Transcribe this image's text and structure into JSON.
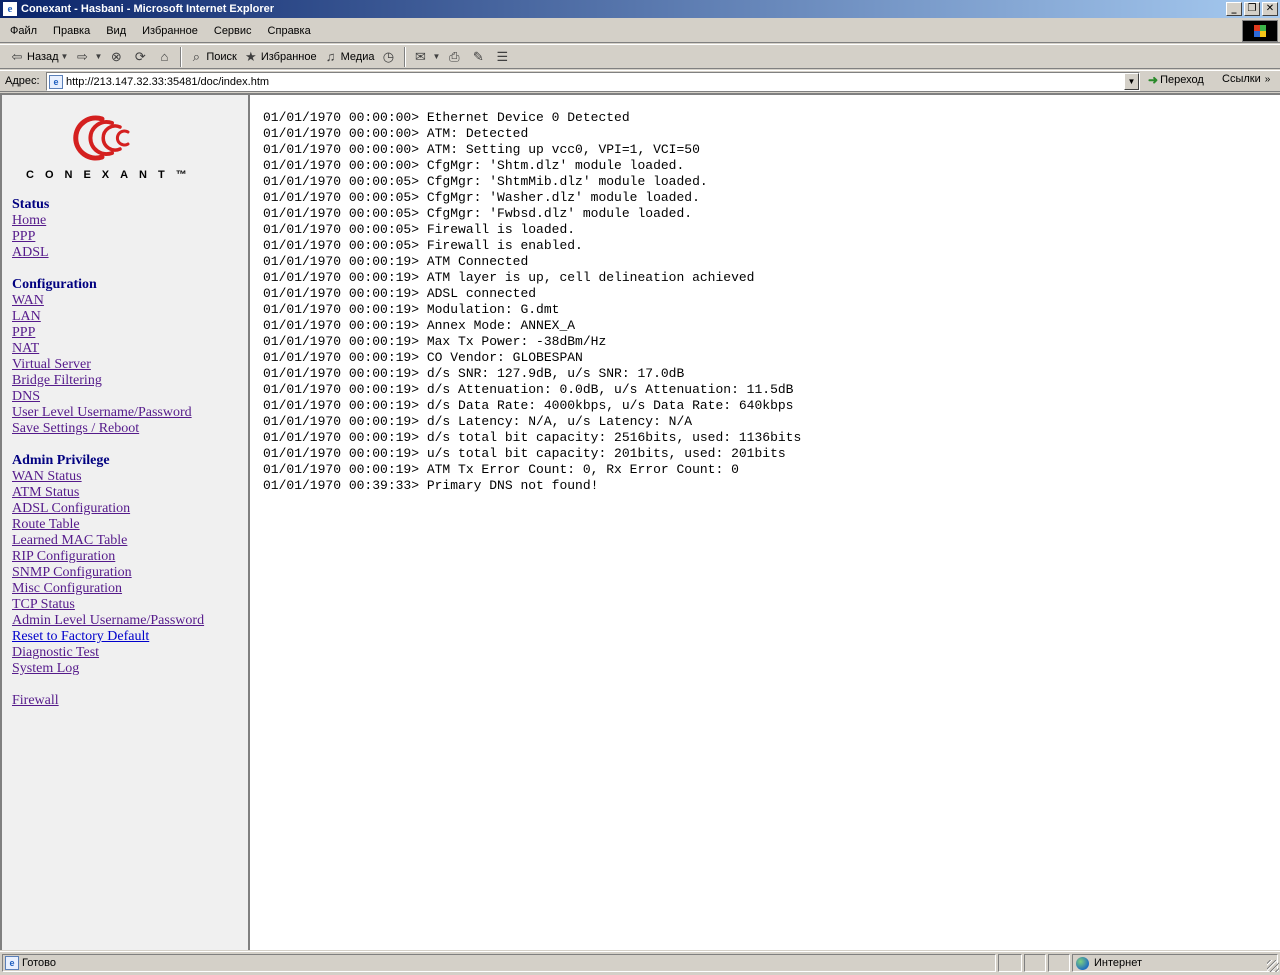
{
  "window": {
    "title": "Conexant - Hasbani - Microsoft Internet Explorer",
    "controls": {
      "minimize": "_",
      "restore": "❐",
      "close": "✕"
    }
  },
  "menubar": {
    "items": [
      "Файл",
      "Правка",
      "Вид",
      "Избранное",
      "Сервис",
      "Справка"
    ]
  },
  "toolbar": {
    "back_label": "Назад",
    "search_label": "Поиск",
    "favorites_label": "Избранное",
    "media_label": "Медиа"
  },
  "address": {
    "label": "Адрес:",
    "url": "http://213.147.32.33:35481/doc/index.htm",
    "go_label": "Переход",
    "links_label": "Ссылки"
  },
  "logo": {
    "wordmark": "CONEXANT™"
  },
  "nav": {
    "sections": [
      {
        "title": "Status",
        "links": [
          "Home",
          "PPP",
          "ADSL"
        ]
      },
      {
        "title": "Configuration",
        "links": [
          "WAN",
          "LAN",
          "PPP",
          "NAT",
          "Virtual Server",
          "Bridge Filtering",
          "DNS",
          "User Level Username/Password",
          "Save Settings / Reboot"
        ]
      },
      {
        "title": "Admin Privilege",
        "links": [
          "WAN Status",
          "ATM Status",
          "ADSL Configuration",
          "Route Table",
          "Learned MAC Table",
          "RIP Configuration",
          "SNMP Configuration",
          "Misc Configuration",
          "TCP Status",
          "Admin Level Username/Password",
          "Reset to Factory Default",
          "Diagnostic Test",
          "System Log"
        ]
      }
    ],
    "extra_link": "Firewall"
  },
  "log": {
    "lines": [
      "01/01/1970 00:00:00> Ethernet Device 0 Detected",
      "01/01/1970 00:00:00> ATM: Detected",
      "01/01/1970 00:00:00> ATM: Setting up vcc0, VPI=1, VCI=50",
      "01/01/1970 00:00:00> CfgMgr: 'Shtm.dlz' module loaded.",
      "01/01/1970 00:00:05> CfgMgr: 'ShtmMib.dlz' module loaded.",
      "01/01/1970 00:00:05> CfgMgr: 'Washer.dlz' module loaded.",
      "01/01/1970 00:00:05> CfgMgr: 'Fwbsd.dlz' module loaded.",
      "01/01/1970 00:00:05> Firewall is loaded.",
      "01/01/1970 00:00:05> Firewall is enabled.",
      "01/01/1970 00:00:19> ATM Connected",
      "01/01/1970 00:00:19> ATM layer is up, cell delineation achieved",
      "01/01/1970 00:00:19> ADSL connected",
      "01/01/1970 00:00:19> Modulation: G.dmt",
      "01/01/1970 00:00:19> Annex Mode: ANNEX_A",
      "01/01/1970 00:00:19> Max Tx Power: -38dBm/Hz",
      "01/01/1970 00:00:19> CO Vendor: GLOBESPAN",
      "01/01/1970 00:00:19> d/s SNR: 127.9dB, u/s SNR: 17.0dB",
      "01/01/1970 00:00:19> d/s Attenuation: 0.0dB, u/s Attenuation: 11.5dB",
      "01/01/1970 00:00:19> d/s Data Rate: 4000kbps, u/s Data Rate: 640kbps",
      "01/01/1970 00:00:19> d/s Latency: N/A, u/s Latency: N/A",
      "01/01/1970 00:00:19> d/s total bit capacity: 2516bits, used: 1136bits",
      "01/01/1970 00:00:19> u/s total bit capacity: 201bits, used: 201bits",
      "01/01/1970 00:00:19> ATM Tx Error Count: 0, Rx Error Count: 0",
      "01/01/1970 00:39:33> Primary DNS not found!"
    ]
  },
  "statusbar": {
    "status_text": "Готово",
    "zone_text": "Интернет"
  },
  "colors": {
    "title_gradient_start": "#0a246a",
    "link_visited": "#551a8b",
    "section_heading": "#000080",
    "logo_red": "#d4201f"
  }
}
